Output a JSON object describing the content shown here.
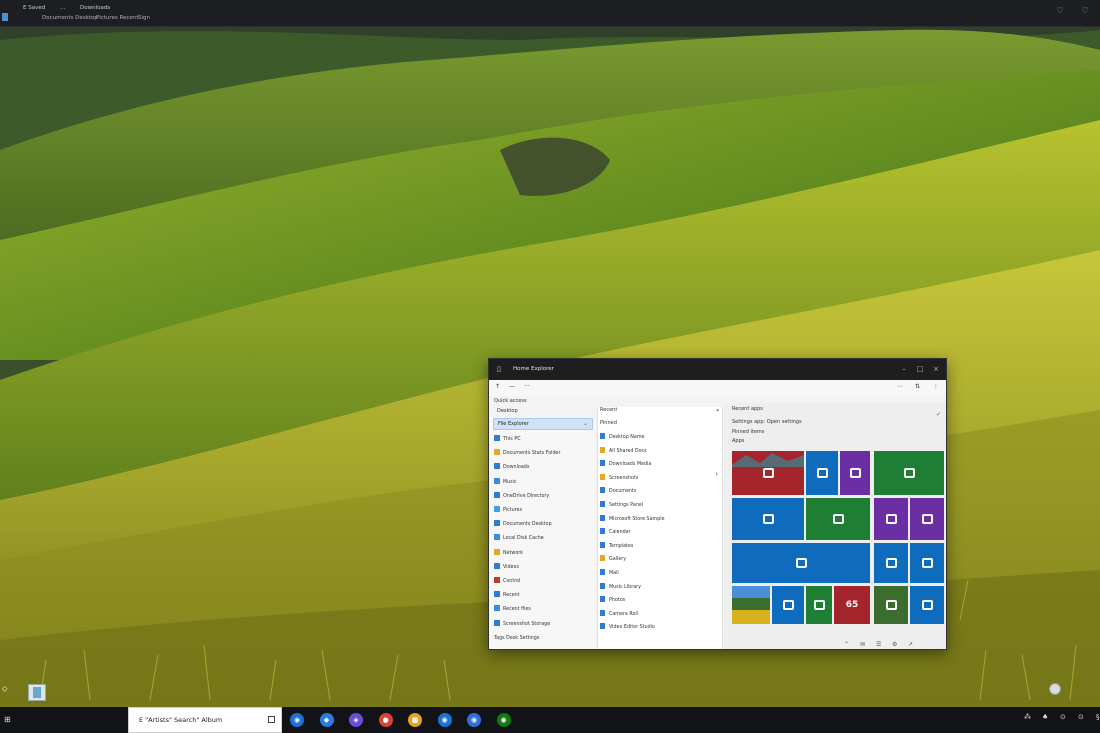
{
  "topbar": {
    "item1": "E Saved",
    "item2": "...",
    "item3": "Downloads",
    "item4": "Documents Desktop",
    "item5": "Pictures Recent",
    "item6": "Sign",
    "ctl_right1": "♡",
    "ctl_right2": "♡"
  },
  "window": {
    "title": "Home Explorer",
    "cmd": {
      "back": "↑",
      "new": "—",
      "menu": "···",
      "view": "⋯"
    },
    "path1": "Quick access",
    "path2": "Desktop"
  },
  "nav": {
    "selected": "File Explorer",
    "items": [
      {
        "label": "This PC",
        "color": "#2e7bd3"
      },
      {
        "label": "Documents Stats Folder",
        "color": "#e2a928"
      },
      {
        "label": "Downloads",
        "color": "#2e7bd3"
      },
      {
        "label": "Music",
        "color": "#3a8ed8"
      },
      {
        "label": "OneDrive Directory",
        "color": "#2e7bd3"
      },
      {
        "label": "Pictures",
        "color": "#3fa1e0"
      },
      {
        "label": "Documents Desktop",
        "color": "#2e7bd3"
      },
      {
        "label": "Local Disk Cache",
        "color": "#3a8ed8"
      },
      {
        "label": "Network",
        "color": "#e2a928"
      },
      {
        "label": "Videos",
        "color": "#2e7bd3"
      },
      {
        "label": "Control",
        "color": "#c0392b"
      },
      {
        "label": "Recent",
        "color": "#2e7bd3"
      },
      {
        "label": "Recent files",
        "color": "#3a8ed8"
      },
      {
        "label": "Screenshot Storage",
        "color": "#2e7bd3"
      }
    ],
    "bottom": "Tags Desk Settings"
  },
  "list": {
    "header": "Recent",
    "header2": "Pinned",
    "items": [
      {
        "label": "Desktop Name",
        "color": "#2e7bd3"
      },
      {
        "label": "All Shared Docs",
        "color": "#e2a928"
      },
      {
        "label": "Downloads Media",
        "color": "#2e7bd3"
      },
      {
        "label": "Screenshots",
        "color": "#e2a928"
      },
      {
        "label": "Documents",
        "color": "#2e7bd3"
      },
      {
        "label": "Settings Panel",
        "color": "#2e7bd3"
      },
      {
        "label": "Microsoft Store Sample",
        "color": "#2e7bd3"
      },
      {
        "label": "Calendar",
        "color": "#2e7bd3"
      },
      {
        "label": "Templates",
        "color": "#2e7bd3"
      },
      {
        "label": "Gallery",
        "color": "#e2a928"
      },
      {
        "label": "Mail",
        "color": "#2e7bd3"
      },
      {
        "label": "Music Library",
        "color": "#2e7bd3"
      },
      {
        "label": "Photos",
        "color": "#2e7bd3"
      },
      {
        "label": "Camera Roll",
        "color": "#2e7bd3"
      },
      {
        "label": "Video Editor Studio",
        "color": "#2e7bd3"
      }
    ]
  },
  "tiles": {
    "line1": "Recent apps",
    "line2": "Settings app: Open settings",
    "line3": "Pinned items",
    "line4": "Apps",
    "footer": [
      "⌃",
      "✉",
      "☰",
      "⚙",
      "↗"
    ],
    "colors": {
      "red": "#a4262c",
      "blue": "#0f6cbd",
      "purple": "#6b2fa3",
      "green": "#1e7f34",
      "mixed": "#3b6d2f"
    }
  },
  "taskbar": {
    "start": "⊞",
    "search_text": "E \"Artists\" Search\" Album",
    "apps": [
      {
        "name": "edge",
        "color": "#1f6fd6",
        "glyph": "◉"
      },
      {
        "name": "store",
        "color": "#2b7be4",
        "glyph": "◆"
      },
      {
        "name": "teams",
        "color": "#6b4bd8",
        "glyph": "◈"
      },
      {
        "name": "chrome",
        "color": "#db4437",
        "glyph": "●"
      },
      {
        "name": "office",
        "color": "#e8a21b",
        "glyph": "■"
      },
      {
        "name": "outlook",
        "color": "#1a73d8",
        "glyph": "◉"
      },
      {
        "name": "mail",
        "color": "#2f6fe0",
        "glyph": "◉"
      },
      {
        "name": "xbox",
        "color": "#107c10",
        "glyph": "◉"
      }
    ],
    "tray": [
      "⁂",
      "♠",
      "⊙",
      "⊙",
      "§"
    ]
  }
}
